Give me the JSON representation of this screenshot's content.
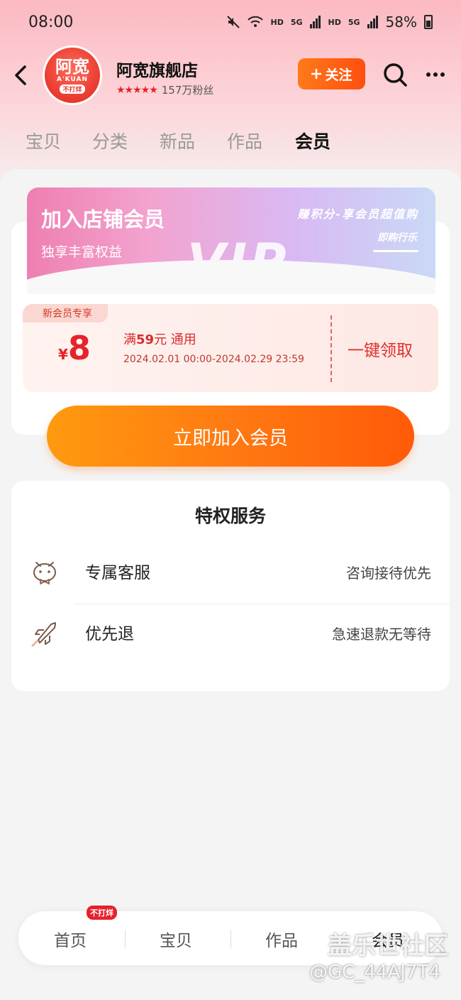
{
  "status_bar": {
    "time": "08:00",
    "indicators": [
      "HD",
      "5G",
      "HD",
      "5G"
    ],
    "battery": "58%"
  },
  "shop": {
    "logo_text": "阿宽",
    "logo_sub": "A'KUAN",
    "logo_tag": "不打烊",
    "name": "阿宽旗舰店",
    "rating_stars": "★★★★★",
    "fans": "157万粉丝",
    "follow_label": "关注"
  },
  "tabs": [
    {
      "label": "宝贝",
      "active": false
    },
    {
      "label": "分类",
      "active": false
    },
    {
      "label": "新品",
      "active": false
    },
    {
      "label": "作品",
      "active": false
    },
    {
      "label": "会员",
      "active": true
    }
  ],
  "vip_banner": {
    "title": "加入店铺会员",
    "subtitle": "独享丰富权益",
    "slogan": "赚积分-享会员超值购",
    "slogan_sub": "即购行乐",
    "mark": "VIP"
  },
  "coupon": {
    "tag": "新会员专享",
    "currency": "¥",
    "amount": "8",
    "condition_prefix": "满",
    "condition_amount": "59",
    "condition_suffix": "元 通用",
    "validity": "2024.02.01 00:00-2024.02.29 23:59",
    "claim_label": "一键领取"
  },
  "join_button": "立即加入会员",
  "privileges": {
    "title": "特权服务",
    "items": [
      {
        "name": "专属客服",
        "desc": "咨询接待优先",
        "icon": "service-bot-icon"
      },
      {
        "name": "优先退",
        "desc": "急速退款无等待",
        "icon": "rocket-icon"
      }
    ]
  },
  "bottom_nav": {
    "items": [
      "首页",
      "宝贝",
      "作品",
      "会员"
    ],
    "badge": "不打烊"
  },
  "watermark": {
    "line1": "盖乐世社区",
    "line2": "@GC_44AJ7T4"
  }
}
